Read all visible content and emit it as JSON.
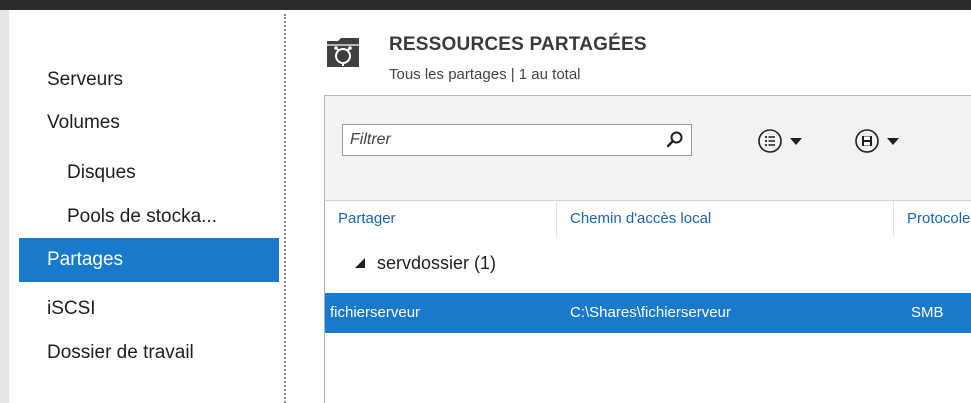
{
  "nav": {
    "items": [
      {
        "label": "Serveurs"
      },
      {
        "label": "Volumes"
      },
      {
        "label": "Disques"
      },
      {
        "label": "Pools de stocka..."
      },
      {
        "label": "Partages"
      },
      {
        "label": "iSCSI"
      },
      {
        "label": "Dossier de travail"
      }
    ]
  },
  "header": {
    "title": "RESSOURCES PARTAGÉES",
    "subtitle": "Tous les partages | 1 au total",
    "icon": "shared-folder-icon"
  },
  "toolbar": {
    "filter_placeholder": "Filtrer",
    "search_icon": "search-icon",
    "view_icon": "list-view-icon",
    "save_icon": "save-icon"
  },
  "table": {
    "columns": [
      "Partager",
      "Chemin d'accès local",
      "Protocole"
    ],
    "group": {
      "label": "servdossier (1)"
    },
    "rows": [
      {
        "share": "fichierserveur",
        "path": "C:\\Shares\\fichierserveur",
        "protocol": "SMB"
      }
    ]
  },
  "colors": {
    "selection": "#1979ca",
    "header_link": "#1a66b0"
  }
}
